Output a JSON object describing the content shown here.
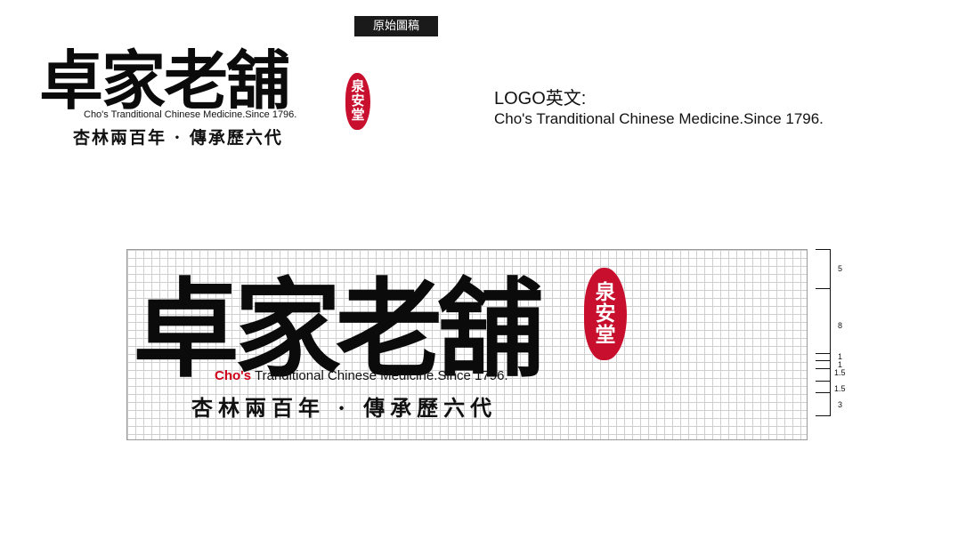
{
  "tag_label": "原始圖稿",
  "brand": {
    "name": "卓家老舖",
    "seal": [
      "泉",
      "安",
      "堂"
    ],
    "english_full": "Cho's Tranditional Chinese Medicine.Since 1796.",
    "english_prefix": "Cho's",
    "english_rest": " Tranditional Chinese Medicine.Since 1796.",
    "slogan": "杏林兩百年 · 傳承歷六代",
    "seal_color": "#c8102e",
    "accent_red": "#d0021b"
  },
  "info": {
    "title": "LOGO英文:",
    "text": "Cho's Tranditional Chinese Medicine.Since 1796."
  },
  "dimensions": [
    "5",
    "8",
    "1",
    "1",
    "1.5",
    "1.5",
    "3"
  ]
}
